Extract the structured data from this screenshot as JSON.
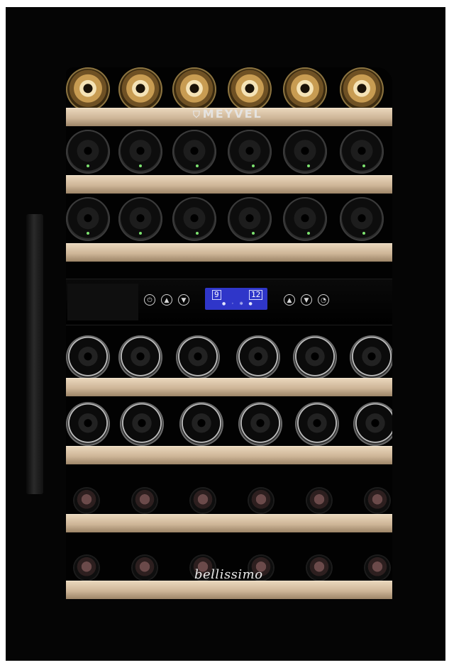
{
  "brand": {
    "logo_text": "MEYVEL",
    "logo_mark": "shield-logo-icon"
  },
  "model_script": "bellissimo",
  "display": {
    "left_temp": "9",
    "right_temp": "12"
  },
  "controls": {
    "left": [
      "power-icon",
      "up-arrow-icon",
      "down-arrow-icon"
    ],
    "right": [
      "up-arrow-icon",
      "down-arrow-icon",
      "light-icon"
    ]
  },
  "colors": {
    "display_blue": "#2f36c9",
    "shelf_wood": "#d9c3a4",
    "body": "#050505"
  }
}
